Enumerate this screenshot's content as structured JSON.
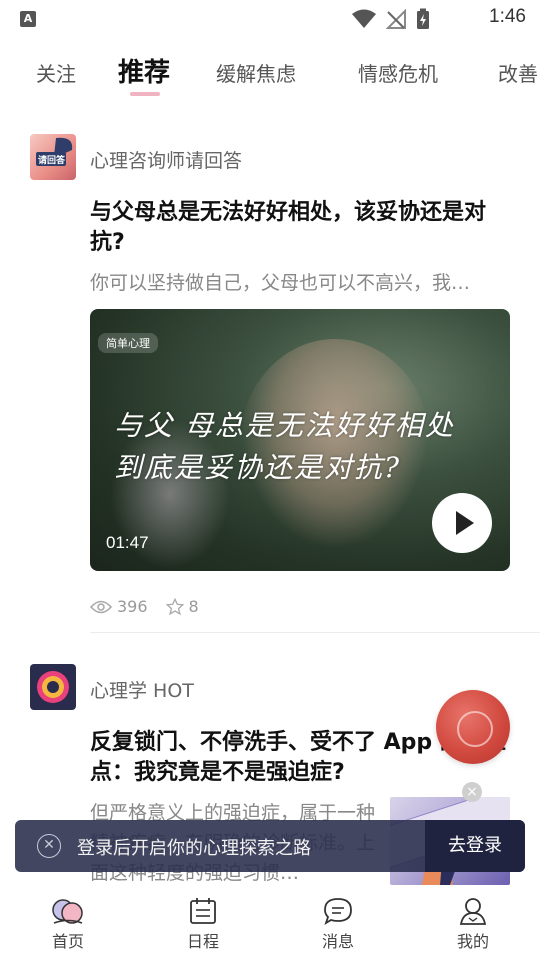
{
  "status_bar": {
    "left_badge": "A",
    "time": "1:46",
    "icons": [
      "wifi-icon",
      "no-signal-icon",
      "battery-charging-icon"
    ]
  },
  "tabs": [
    {
      "label": "关注",
      "active": false
    },
    {
      "label": "推荐",
      "active": true
    },
    {
      "label": "缓解焦虑",
      "active": false
    },
    {
      "label": "情感危机",
      "active": false
    },
    {
      "label": "改善",
      "active": false
    }
  ],
  "articles": [
    {
      "source": "心理咨询师请回答",
      "avatar_text": "请回答",
      "title": "与父母总是无法好好相处，该妥协还是对抗?",
      "excerpt": "你可以坚持做自己，父母也可以不高兴，我…",
      "video": {
        "badge": "简单心理",
        "caption": "与父 母总是无法好好相处 到底是妥协还是对抗?",
        "duration": "01:47"
      },
      "views": "396",
      "stars": "8"
    },
    {
      "source": "心理学 HOT",
      "title": "反复锁门、不停洗手、受不了 App 的小红点：我究竟是不是强迫症?",
      "excerpt": "但严格意义上的强迫症，属于一种精神疾病，有明确的诊断标准。上面这种轻度的强迫习惯…"
    }
  ],
  "login_banner": {
    "message": "登录后开启你的心理探索之路",
    "button": "去登录"
  },
  "bottom_nav": [
    {
      "label": "首页",
      "icon": "home-bubbles-icon",
      "active": true
    },
    {
      "label": "日程",
      "icon": "calendar-icon",
      "active": false
    },
    {
      "label": "消息",
      "icon": "message-icon",
      "active": false
    },
    {
      "label": "我的",
      "icon": "profile-icon",
      "active": false
    }
  ],
  "colors": {
    "tab_indicator": "#f0b3c1",
    "banner_bg": "#282c4b",
    "float_coin": "#d24a40"
  }
}
